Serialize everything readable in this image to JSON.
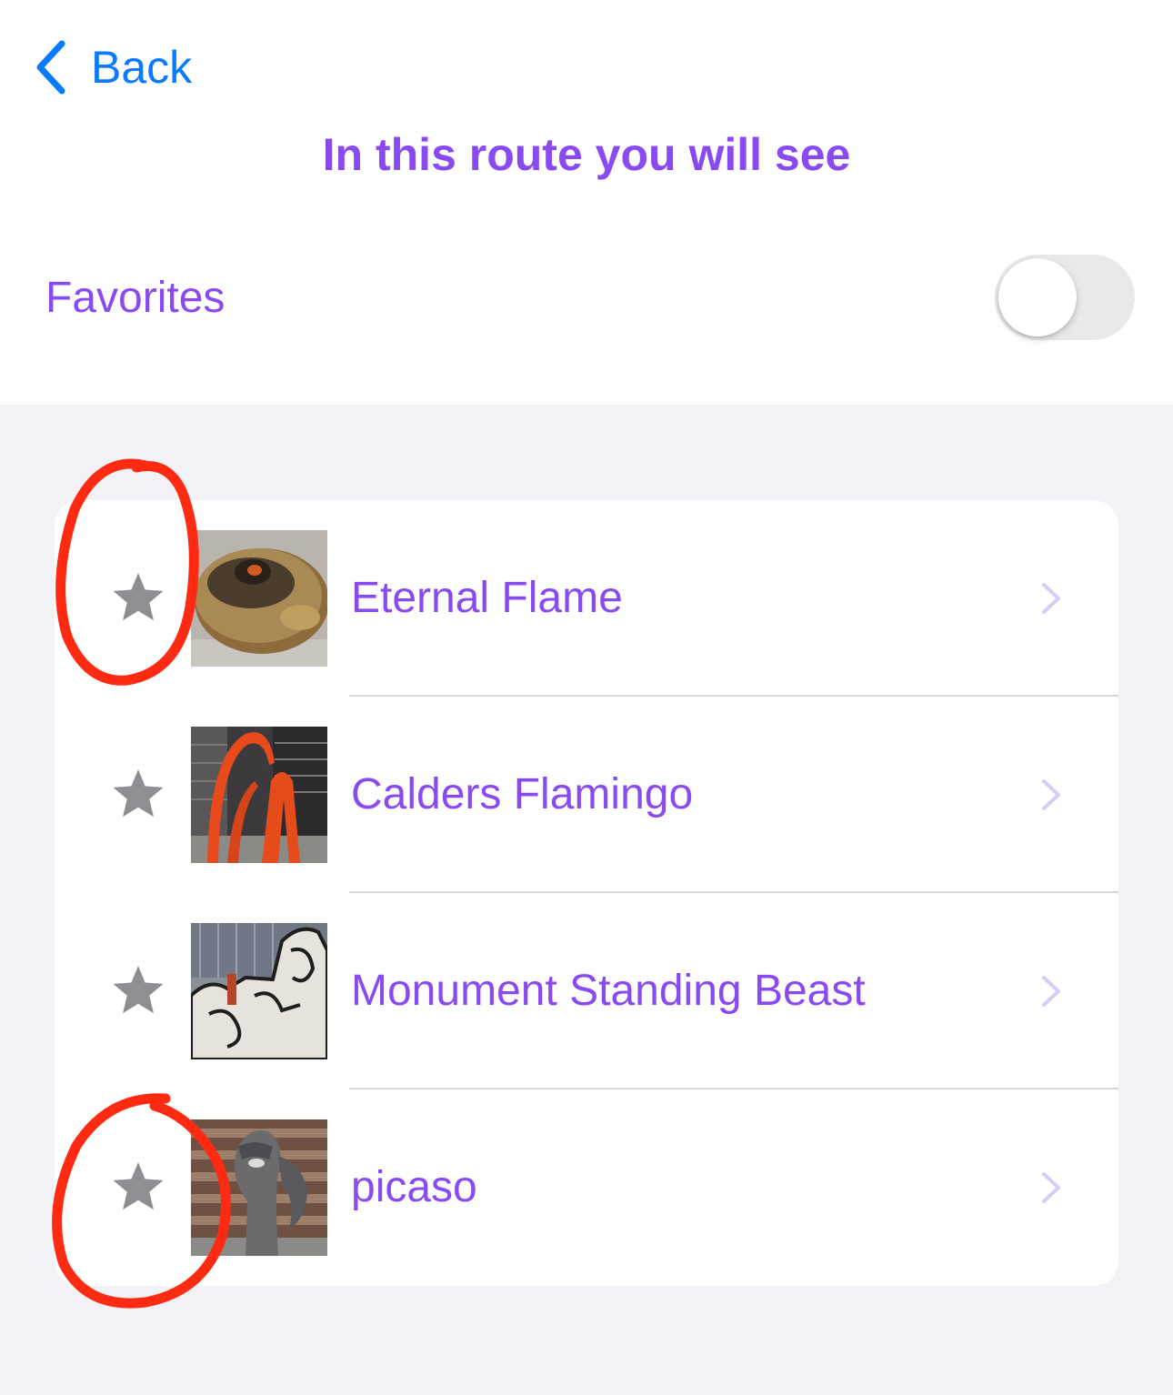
{
  "nav": {
    "back_label": "Back"
  },
  "page": {
    "title": "In this route you will see"
  },
  "favorites": {
    "label": "Favorites",
    "enabled": false
  },
  "colors": {
    "accent": "#8a4af2",
    "back_blue": "#0a7aff",
    "star_gray": "#8e8e93",
    "chevron": "#d9ccf8",
    "annotation_red": "#ff2a12"
  },
  "items": [
    {
      "label": "Eternal Flame",
      "icon": "star-icon",
      "favorite": false
    },
    {
      "label": "Calders Flamingo",
      "icon": "star-icon",
      "favorite": false
    },
    {
      "label": "Monument Standing Beast",
      "icon": "star-icon",
      "favorite": false
    },
    {
      "label": "picaso",
      "icon": "star-icon",
      "favorite": false
    }
  ]
}
